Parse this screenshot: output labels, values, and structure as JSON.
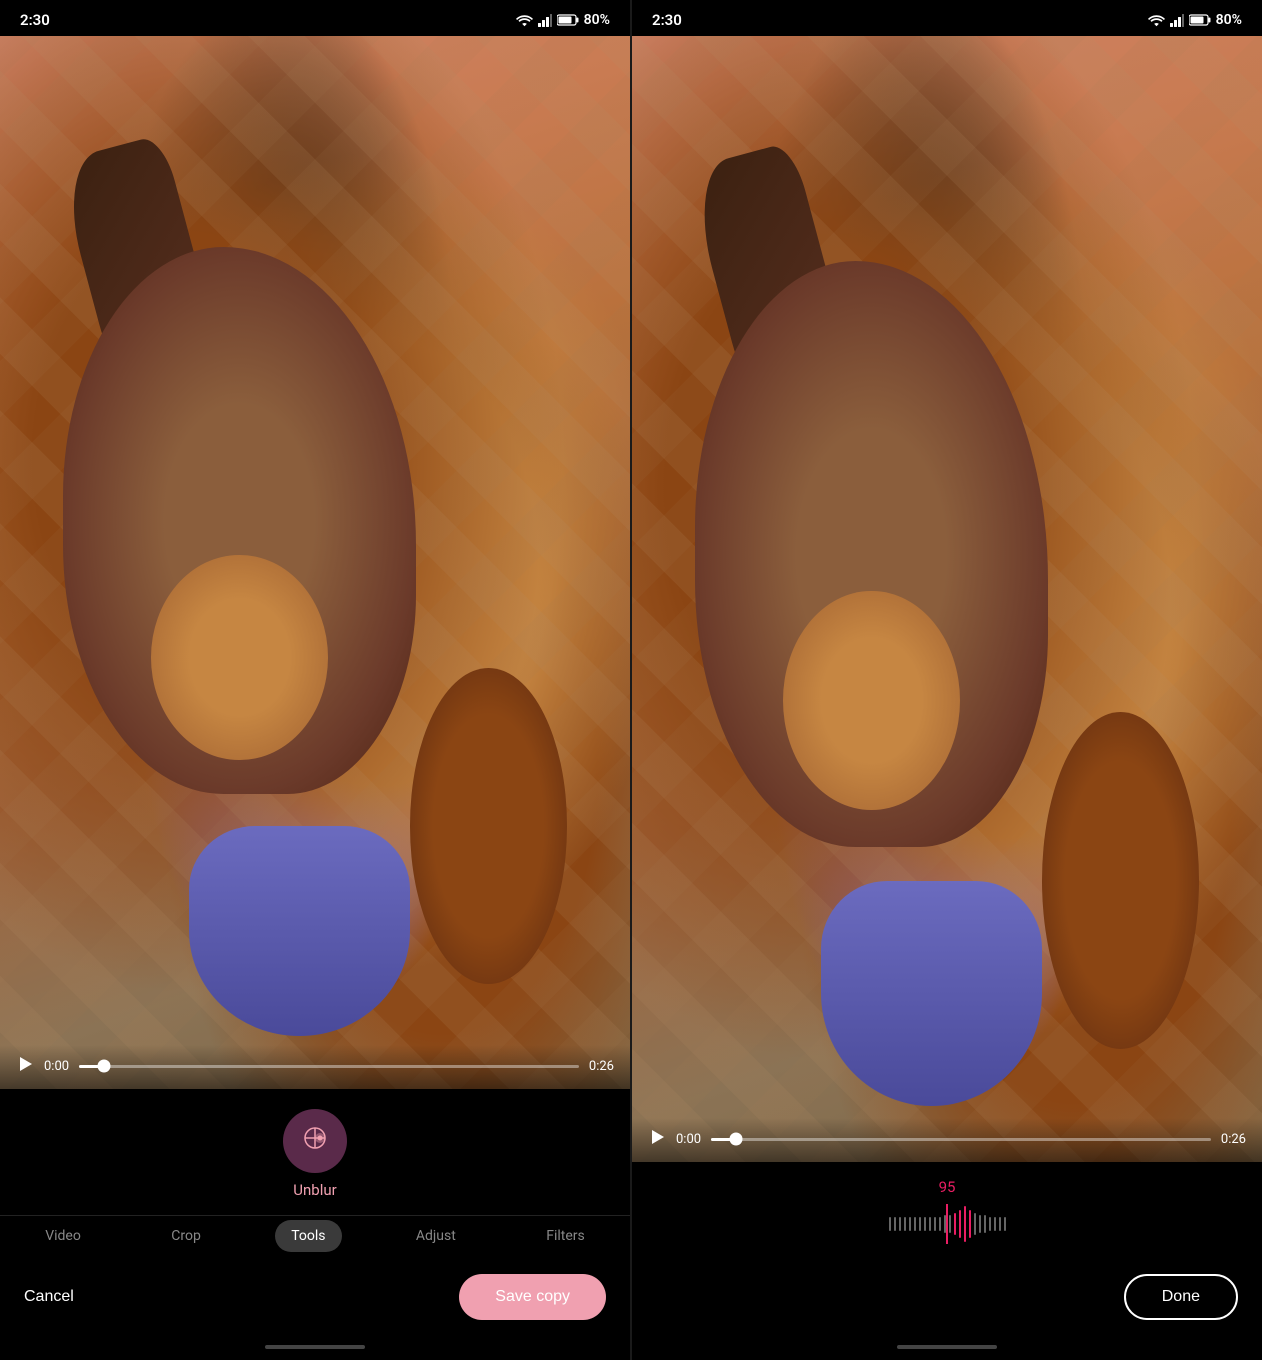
{
  "left_panel": {
    "status_bar": {
      "time": "2:30",
      "battery": "80%"
    },
    "video": {
      "current_time": "0:00",
      "end_time": "0:26",
      "progress_percent": 5
    },
    "tool": {
      "name": "Unblur",
      "icon": "⊙"
    },
    "tabs": [
      {
        "id": "video",
        "label": "Video",
        "active": false
      },
      {
        "id": "crop",
        "label": "Crop",
        "active": false
      },
      {
        "id": "tools",
        "label": "Tools",
        "active": true
      },
      {
        "id": "adjust",
        "label": "Adjust",
        "active": false
      },
      {
        "id": "filters",
        "label": "Filters",
        "active": false
      }
    ],
    "actions": {
      "cancel": "Cancel",
      "save": "Save copy"
    }
  },
  "right_panel": {
    "status_bar": {
      "time": "2:30",
      "battery": "80%"
    },
    "video": {
      "current_time": "0:00",
      "end_time": "0:26",
      "progress_percent": 5
    },
    "adjustment": {
      "value": 95,
      "ticks": 20
    },
    "actions": {
      "done": "Done"
    }
  },
  "colors": {
    "accent": "#f0a0b0",
    "accent_dark": "#e91e63",
    "tool_bg": "#5a2a4a",
    "active_tab_bg": "#3a3a3a"
  }
}
